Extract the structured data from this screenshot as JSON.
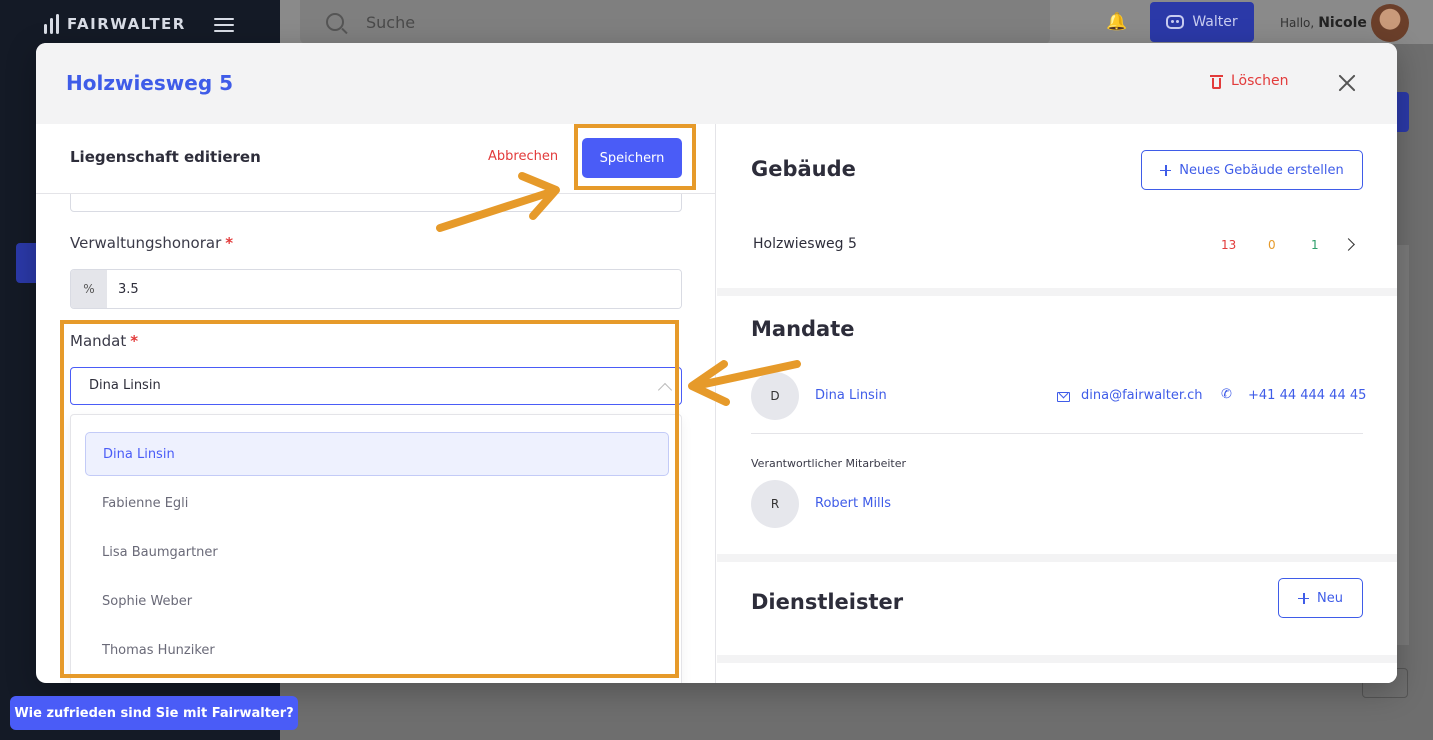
{
  "app": {
    "logo": "FAIRWALTER",
    "search_placeholder": "Suche",
    "assistant_label": "Walter",
    "greeting": "Hallo,",
    "user_name": "Nicole",
    "feedback_label": "Wie zufrieden sind Sie mit Fairwalter?"
  },
  "modal": {
    "title": "Holzwiesweg 5",
    "delete_label": "Löschen",
    "edit_panel": {
      "title": "Liegenschaft editieren",
      "cancel_label": "Abbrechen",
      "save_label": "Speichern",
      "fee": {
        "label": "Verwaltungshonorar",
        "required_mark": "*",
        "addon": "%",
        "value": "3.5"
      },
      "mandate": {
        "label": "Mandat",
        "required_mark": "*",
        "selected": "Dina Linsin",
        "options": [
          "Dina Linsin",
          "Fabienne Egli",
          "Lisa Baumgartner",
          "Sophie Weber",
          "Thomas Hunziker"
        ]
      }
    },
    "buildings": {
      "title": "Gebäude",
      "new_button": "Neues Gebäude erstellen",
      "items": [
        {
          "name": "Holzwiesweg 5",
          "count_red": "13",
          "count_orange": "0",
          "count_green": "1"
        }
      ]
    },
    "mandates": {
      "title": "Mandate",
      "owner": {
        "initial": "D",
        "name": "Dina Linsin",
        "email": "dina@fairwalter.ch",
        "phone": "+41 44 444 44 45"
      },
      "responsible_label": "Verantwortlicher Mitarbeiter",
      "responsible": {
        "initial": "R",
        "name": "Robert Mills"
      }
    },
    "providers": {
      "title": "Dienstleister",
      "new_button": "Neu"
    }
  },
  "colors": {
    "accent": "#3f5ce8",
    "primary_button": "#4a5cf7",
    "danger": "#e23b3b",
    "highlight": "#e69a2a",
    "count_red": "#e23b3b",
    "count_orange": "#e69a2a",
    "count_green": "#2e9e6a"
  }
}
